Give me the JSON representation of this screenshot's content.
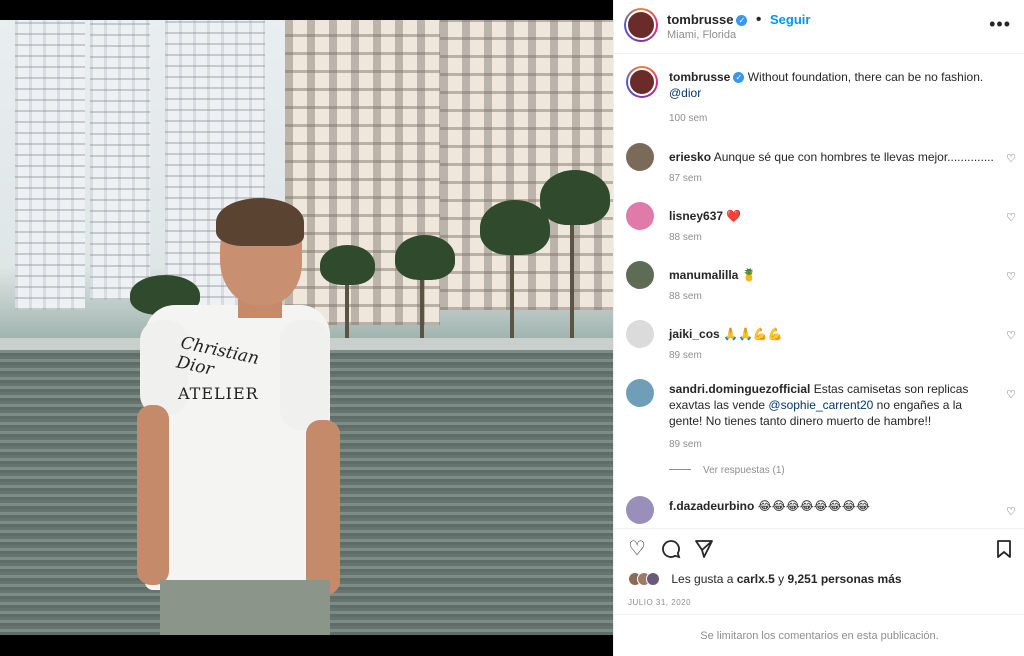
{
  "post": {
    "username": "tombrusse",
    "follow_label": "Seguir",
    "location": "Miami, Florida",
    "verified": true,
    "caption": "Without foundation, there can be no fashion.",
    "caption_mention": "@dior",
    "caption_time": "100 sem",
    "image": {
      "shirt_brand": "Christian Dior",
      "shirt_line": "ATELIER"
    }
  },
  "comments": [
    {
      "user": "eriesko",
      "text": "Aunque sé que con hombres te llevas mejor..............",
      "time": "87 sem",
      "avatar_color": "#7a6a58"
    },
    {
      "user": "lisney637",
      "text": "❤️",
      "time": "88 sem",
      "avatar_color": "#e07aa8"
    },
    {
      "user": "manumalilla",
      "text": "🍍",
      "time": "88 sem",
      "avatar_color": "#5e6b55"
    },
    {
      "user": "jaiki_cos",
      "text": "🙏🙏💪💪",
      "time": "89 sem",
      "avatar_color": "#dbdbdb"
    },
    {
      "user": "sandri.dominguezofficial",
      "text_before": "Estas camisetas son replicas exavtas las vende",
      "mention": "@sophie_carrent20",
      "text_after": "no engañes a la gente! No tienes tanto dinero muerto de hambre!!",
      "time": "89 sem",
      "avatar_color": "#6f9fb8"
    },
    {
      "user": "f.dazadeurbino",
      "text": "😂😂😂😂😂😂😂😂",
      "avatar_color": "#9a8fb8"
    }
  ],
  "view_replies": "Ver respuestas (1)",
  "actions": {
    "like_icon": "heart-icon",
    "comment_icon": "comment-icon",
    "share_icon": "paper-plane-icon",
    "save_icon": "bookmark-icon"
  },
  "likes": {
    "prefix": "Les gusta a",
    "user": "carlx.5",
    "middle": "y",
    "count": "9,251 personas más"
  },
  "date": "JULIO 31, 2020",
  "footer": "Se limitaron los comentarios en esta publicación.",
  "colors": {
    "accent": "#0095f6",
    "verified": "#3897f0",
    "muted": "#8e8e8e",
    "mention": "#00376b"
  }
}
